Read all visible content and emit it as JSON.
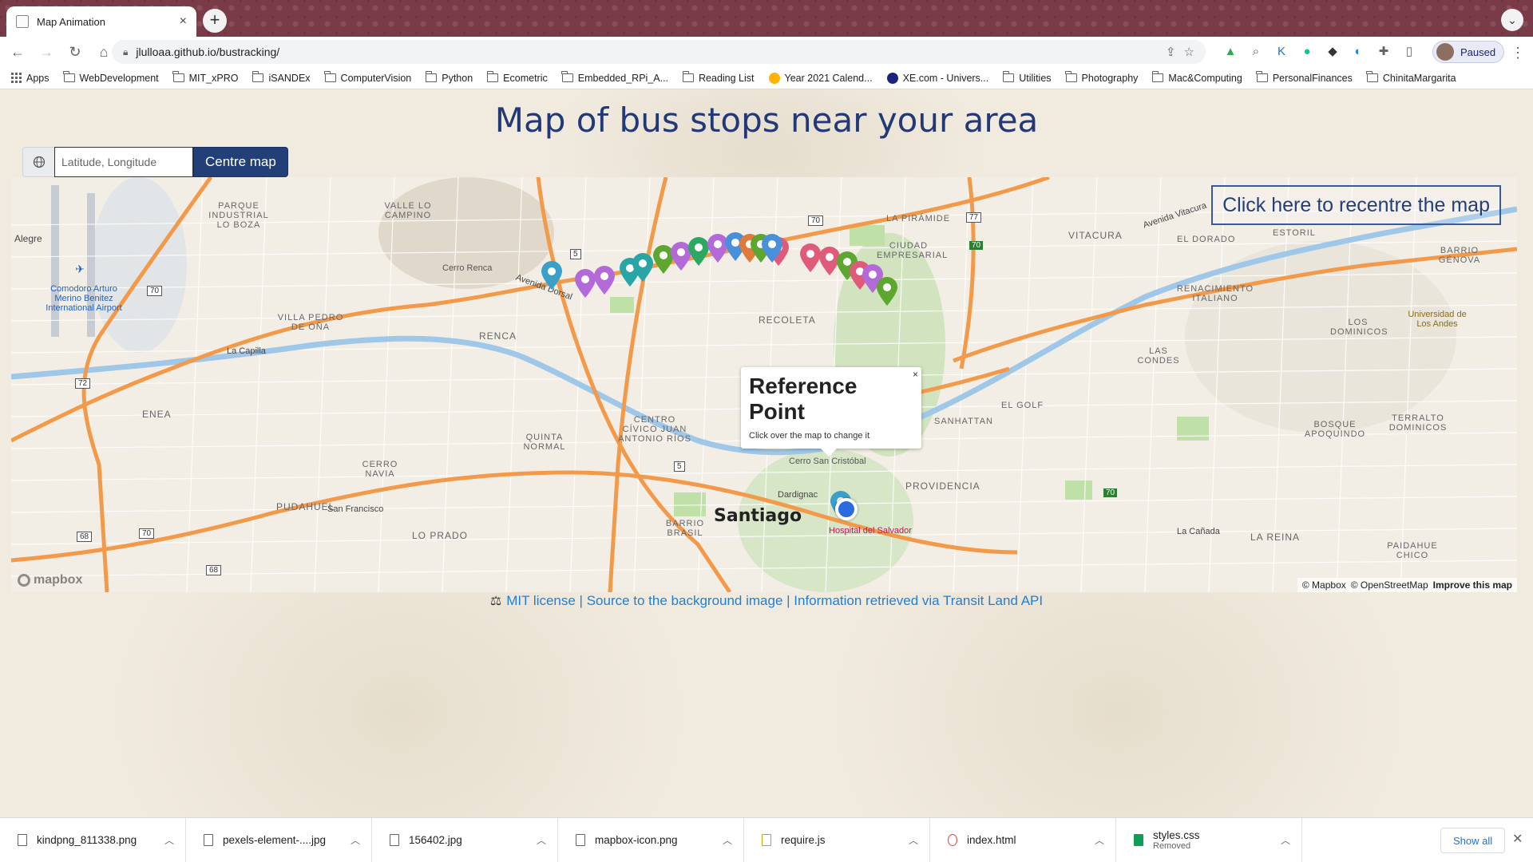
{
  "browser": {
    "tab_title": "Map Animation",
    "url": "jlulloaa.github.io/bustracking/",
    "profile_label": "Paused",
    "bookmarks": [
      "Apps",
      "WebDevelopment",
      "MIT_xPRO",
      "iSANDEx",
      "ComputerVision",
      "Python",
      "Ecometric",
      "Embedded_RPi_A...",
      "Reading List",
      "Year 2021 Calend...",
      "XE.com - Univers...",
      "Utilities",
      "Photography",
      "Mac&Computing",
      "PersonalFinances",
      "ChinitaMargarita"
    ]
  },
  "page": {
    "title": "Map of bus stops near your area",
    "search_placeholder": "Latitude, Longitude",
    "centre_button": "Centre map",
    "recenter_button": "Click here to recentre the map"
  },
  "map": {
    "popup_title": "Reference Point",
    "popup_subtitle": "Click over the map to change it",
    "popup_close": "×",
    "logo": "mapbox",
    "attribution_mapbox": "© Mapbox",
    "attribution_osm": "© OpenStreetMap",
    "attribution_improve": "Improve this map",
    "labels": {
      "santiago": "Santiago",
      "renca": "RENCA",
      "recoleta": "RECOLETA",
      "providencia": "PROVIDENCIA",
      "vitacura": "VITACURA",
      "las_condes": "LAS CONDES",
      "quinta_normal": "QUINTA NORMAL",
      "pudahuel": "PUDAHUEL",
      "lo_prado": "LO PRADO",
      "cerro_navia": "CERRO NAVIA",
      "cerro_renca": "Cerro Renca",
      "cerro_san_cristobal": "Cerro San Cristóbal",
      "hospital": "Hospital del Salvador",
      "airport": "Comodoro Arturo Merino Benitez International Airport",
      "parque": "PARQUE INDUSTRIAL LO BOZA",
      "la_piramide": "LA PIRÁMIDE",
      "ciudad_empresarial": "CIUDAD EMPRESARIAL",
      "el_golf": "EL GOLF",
      "san_francisco": "San Francisco",
      "barrio_brasil": "BARRIO BRASIL",
      "la_reina": "LA REINA",
      "la_canada": "La Cañada",
      "universidad_andes": "Universidad de Los Andes",
      "villa_pedro": "VILLA PEDRO DE OÑA",
      "la_capilla": "La Capilla",
      "enea": "ENEA",
      "valle_lo_campino": "VALLE LO CAMPINO",
      "alegre": "Alegre",
      "avenida_dorsal": "Avenida Dorsal",
      "avenida_vitacura": "Avenida Vitacura",
      "sanhattan": "SANHATTAN",
      "el_dorado": "EL DORADO",
      "estoril": "ESTORIL",
      "los_dominicos": "LOS DOMINICOS",
      "bosque_apoquindo": "BOSQUE APOQUINDO",
      "terralto": "TERRALTO DOMINICOS",
      "paidahue": "PAIDAHUE CHICO",
      "renacimiento": "RENACIMIENTO ITALIANO",
      "barrio_genova": "BARRIO GÉNOVA",
      "centro_civico": "CENTRO CÍVICO JUAN ANTONIO RÍOS",
      "dardignac": "Dardignac",
      "road_70": "70",
      "road_5": "5",
      "road_68": "68",
      "road_72": "72",
      "road_77": "77"
    }
  },
  "footer": {
    "icon": "⚖",
    "text": "MIT license | Source to the background image | Information retrieved via Transit Land API"
  },
  "downloads": [
    {
      "name": "kindpng_811338.png",
      "status": ""
    },
    {
      "name": "pexels-element-....jpg",
      "status": ""
    },
    {
      "name": "156402.jpg",
      "status": ""
    },
    {
      "name": "mapbox-icon.png",
      "status": ""
    },
    {
      "name": "require.js",
      "status": ""
    },
    {
      "name": "index.html",
      "status": ""
    },
    {
      "name": "styles.css",
      "status": "Removed"
    }
  ],
  "shelf": {
    "show_all": "Show all",
    "close": "✕"
  },
  "colors": {
    "title": "#233876",
    "button": "#233f78",
    "link": "#1f7fd6",
    "route": "#f39a4a"
  }
}
